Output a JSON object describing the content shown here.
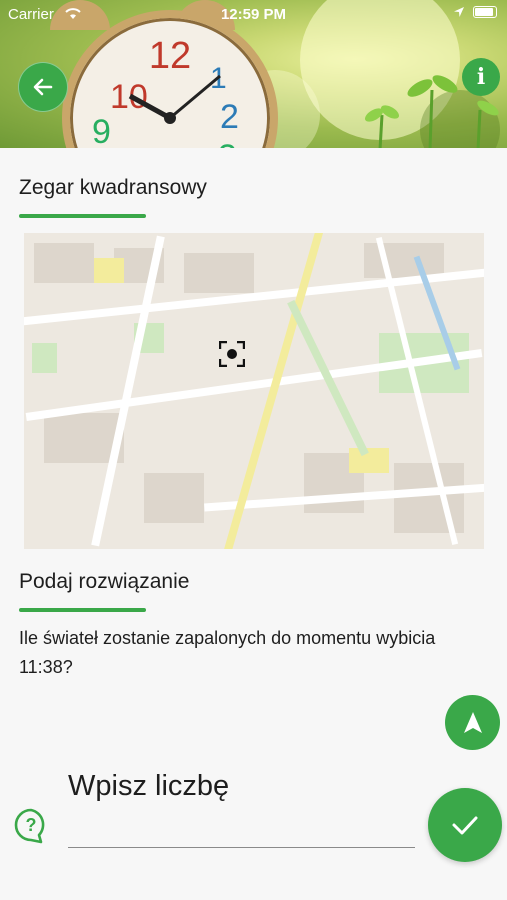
{
  "status_bar": {
    "carrier": "Carrier",
    "time": "12:59 PM"
  },
  "header": {
    "back_icon": "arrow-left-icon",
    "info_label": "i"
  },
  "task": {
    "title": "Zegar kwadransowy"
  },
  "map": {
    "marker_icon": "target-icon"
  },
  "solution": {
    "title": "Podaj rozwiązanie",
    "question": "Ile świateł zostanie zapalonych do momentu wybicia 11:38?",
    "input_label": "Wpisz liczbę"
  },
  "actions": {
    "navigate_icon": "navigation-arrow-icon",
    "help_icon": "question-bubble-icon",
    "submit_icon": "checkmark-icon"
  },
  "colors": {
    "accent": "#3aa849"
  }
}
